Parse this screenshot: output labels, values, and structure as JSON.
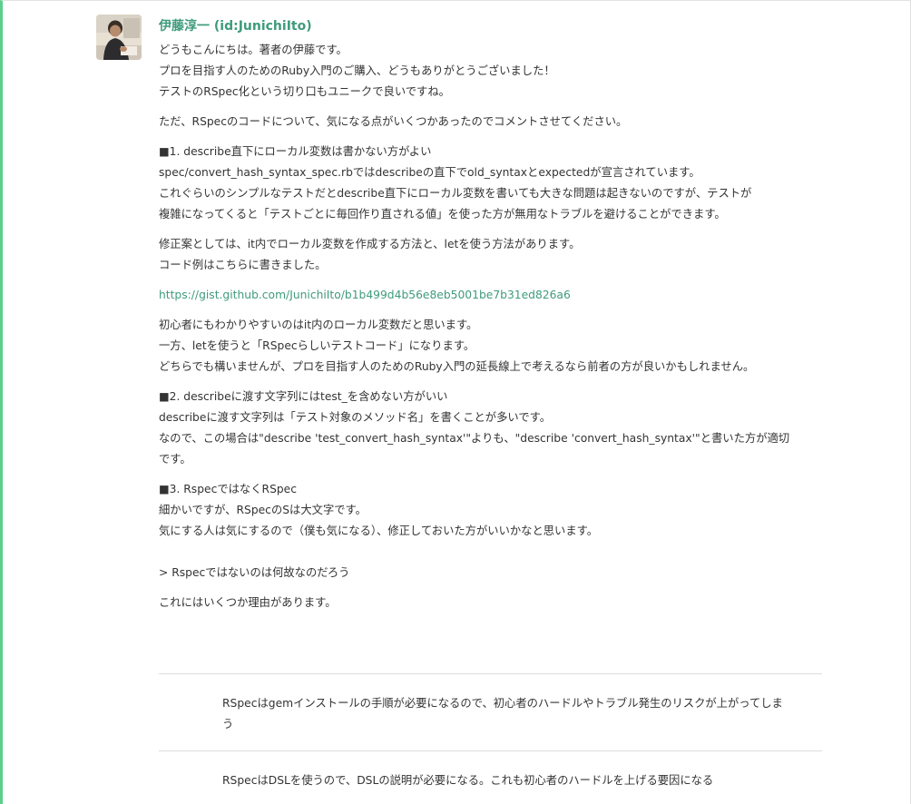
{
  "author": {
    "name": "伊藤淳一 (id:JunichiIto)",
    "avatar_icon": "user-avatar-photo"
  },
  "comment": {
    "paragraphs": [
      {
        "lines": [
          "どうもこんにちは。著者の伊藤です。",
          "プロを目指す人のためのRuby入門のご購入、どうもありがとうございました！",
          "テストのRSpec化という切り口もユニークで良いですね。"
        ]
      },
      {
        "lines": [
          "ただ、RSpecのコードについて、気になる点がいくつかあったのでコメントさせてください。"
        ]
      },
      {
        "lines": [
          "■1. describe直下にローカル変数は書かない方がよい",
          "spec/convert_hash_syntax_spec.rbではdescribeの直下でold_syntaxとexpectedが宣言されています。",
          "これぐらいのシンプルなテストだとdescribe直下にローカル変数を書いても大きな問題は起きないのですが、テストが",
          "複雑になってくると「テストごとに毎回作り直される値」を使った方が無用なトラブルを避けることができます。"
        ]
      },
      {
        "lines": [
          "修正案としては、it内でローカル変数を作成する方法と、letを使う方法があります。",
          "コード例はこちらに書きました。"
        ]
      },
      {
        "link": "https://gist.github.com/JunichiIto/b1b499d4b56e8eb5001be7b31ed826a6"
      },
      {
        "lines": [
          "初心者にもわかりやすいのはit内のローカル変数だと思います。",
          "一方、letを使うと「RSpecらしいテストコード」になります。",
          "どちらでも構いませんが、プロを目指す人のためのRuby入門の延長線上で考えるなら前者の方が良いかもしれません。"
        ]
      },
      {
        "lines": [
          "■2. describeに渡す文字列にはtest_を含めない方がいい",
          "describeに渡す文字列は「テスト対象のメソッド名」を書くことが多いです。",
          "なので、この場合は\"describe 'test_convert_hash_syntax'\"よりも、\"describe 'convert_hash_syntax'\"と書いた方が適切",
          "です。"
        ]
      },
      {
        "lines": [
          "■3. RspecではなくRSpec",
          "細かいですが、RSpecのSは大文字です。",
          "気にする人は気にするので（僕も気になる）、修正しておいた方がいいかなと思います。"
        ]
      },
      {
        "lines": [
          "> Rspecではないのは何故なのだろう"
        ]
      },
      {
        "lines": [
          "これにはいくつか理由があります。"
        ]
      }
    ]
  },
  "quotes": [
    {
      "text": "RSpecはgemインストールの手順が必要になるので、初心者のハードルやトラブル発生のリスクが上がってしまう"
    },
    {
      "text": "RSpecはDSLを使うので、DSLの説明が必要になる。これも初心者のハードルを上げる要因になる"
    }
  ]
}
